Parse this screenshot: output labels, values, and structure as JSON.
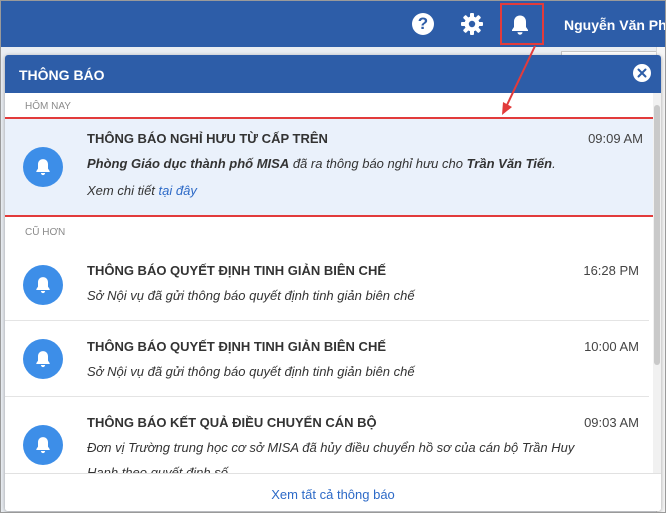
{
  "topbar": {
    "username": "Nguyễn Văn Phư",
    "help_glyph": "?",
    "icons": [
      "help-icon",
      "gear-icon",
      "bell-icon"
    ]
  },
  "panel": {
    "title": "THÔNG BÁO",
    "section_today": "HÔM NAY",
    "section_older": "CŨ HƠN",
    "footer_link": "Xem tất cả thông báo",
    "active_highlight_color": "#e23b3b"
  },
  "notifications": [
    {
      "title": "THÔNG BÁO NGHỈ HƯU TỪ CẤP TRÊN",
      "time": "09:09 AM",
      "msg_part1": "Phòng Giáo dục thành phố MISA",
      "msg_part2": " đã ra thông báo nghỉ hưu cho ",
      "msg_part3": "Trần Văn Tiến",
      "msg_part4": ".",
      "detail_text": "Xem chi tiết ",
      "detail_link": "tại đây"
    },
    {
      "title": "THÔNG BÁO QUYẾT ĐỊNH TINH GIẢN BIÊN CHẾ",
      "time": "16:28 PM",
      "message": "Sở Nội vụ đã gửi thông báo quyết định tinh giản biên chế"
    },
    {
      "title": "THÔNG BÁO QUYẾT ĐỊNH TINH GIẢN BIÊN CHẾ",
      "time": "10:00 AM",
      "message": "Sở Nội vụ đã gửi thông báo quyết định tinh giản biên chế"
    },
    {
      "title": "THÔNG BÁO KẾT QUẢ ĐIỀU CHUYỂN CÁN BỘ",
      "time": "09:03 AM",
      "message": "Đơn vị Trường trung học cơ sở MISA đã hủy điều chuyển hồ sơ của cán bộ Trần Huy Hanh theo quyết định số ."
    }
  ]
}
